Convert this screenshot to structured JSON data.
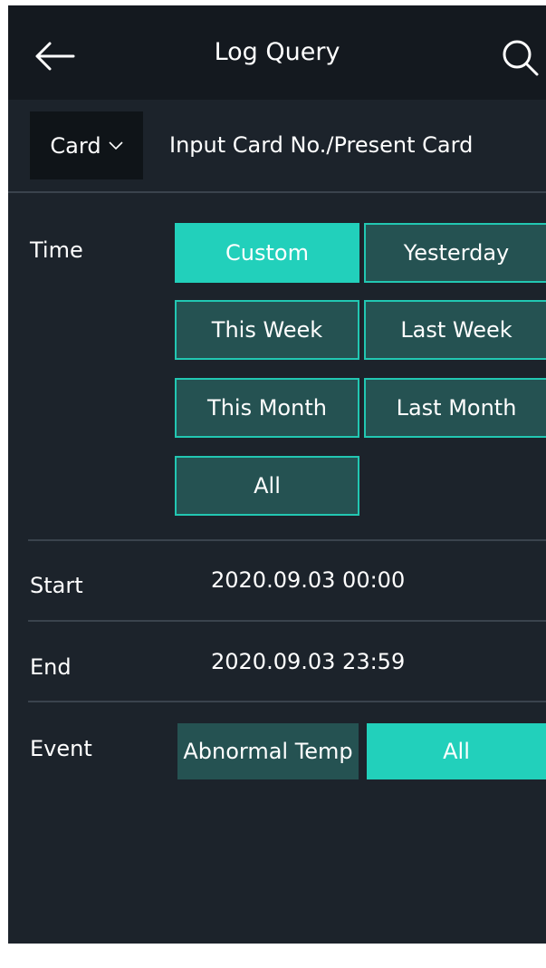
{
  "header": {
    "title": "Log Query",
    "back_icon": "back-arrow-icon",
    "search_icon": "search-icon"
  },
  "card_filter": {
    "selected": "Card",
    "input_placeholder": "Input Card No./Present Card"
  },
  "time": {
    "label": "Time",
    "options": [
      "Custom",
      "Yesterday",
      "This Week",
      "Last Week",
      "This Month",
      "Last Month",
      "All"
    ],
    "selected": "Custom"
  },
  "start": {
    "label": "Start",
    "value": "2020.09.03 00:00"
  },
  "end": {
    "label": "End",
    "value": "2020.09.03 23:59"
  },
  "event": {
    "label": "Event",
    "options": [
      "Abnormal Temp",
      "All"
    ],
    "selected": "All"
  },
  "colors": {
    "background": "#1c232b",
    "header": "#14191f",
    "accent": "#22d0bb",
    "option_bg": "#255252"
  }
}
